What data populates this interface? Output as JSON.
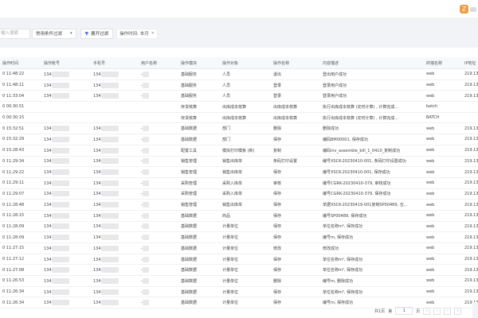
{
  "topbar": {
    "badge_text": "Z",
    "accent": "#f39a3c"
  },
  "filters": {
    "search_placeholder": "输入搜索",
    "common_filter": "常用条件过滤",
    "expand_label": "展开过滤",
    "tag_label": "操作时间: 本月"
  },
  "table": {
    "columns": [
      "操作时间",
      "操作账号",
      "手机号",
      "用户名称",
      "操作模块",
      "操作对象",
      "操作名称",
      "内容描述",
      "终端名称",
      "IP地址"
    ],
    "rows": [
      [
        "0 11:48:22",
        "134",
        "134",
        "-",
        "基础服务",
        "人员",
        "退出",
        "登出用户成功",
        "web",
        "219.13"
      ],
      [
        "0 11:48:11",
        "134",
        "134",
        "-",
        "基础服务",
        "人员",
        "登录",
        "登录用户成功",
        "web",
        "219.13"
      ],
      [
        "0 11:33:04",
        "134",
        "134",
        "-",
        "基础服务",
        "人员",
        "登录",
        "登录用户成功",
        "web",
        "219.13"
      ],
      [
        "0 00:30:51",
        "",
        "",
        "",
        "存货核算",
        "出库成本核算",
        "出库成本核算",
        "执行出库成本核算 (定时计算) , 计算完成...",
        "batch",
        ""
      ],
      [
        "0 00:30:15",
        "",
        "",
        "",
        "存货核算",
        "出库成本核算",
        "出库成本核算",
        "执行出库成本核算 (定时计算) , 计算完成...",
        "BATCH",
        ""
      ],
      [
        "0 15:32:51",
        "134",
        "134",
        "-",
        "基础数据",
        "部门",
        "删除",
        "删除成功",
        "web",
        "219.13"
      ],
      [
        "0 15:32:29",
        "134",
        "134",
        "-",
        "基础数据",
        "部门",
        "保存",
        "编码BM00001, 保存成功",
        "web",
        "219.13"
      ],
      [
        "0 15:28:43",
        "134",
        "134",
        "-",
        "配置工具",
        "模拟打印模板 (新)",
        "复制",
        "编码inv_assemble_bill_1_0410_复制成功",
        "web",
        "219.13"
      ],
      [
        "0 11:29:34",
        "134",
        "134",
        "-",
        "销售管理",
        "销售出库单",
        "条码打印设置",
        "编号XSCK-20230410-001, 条码打印设置成功",
        "web",
        "219.13"
      ],
      [
        "0 11:29:22",
        "134",
        "134",
        "-",
        "销售管理",
        "销售出库单",
        "保存",
        "编号XSCK-20230410-001, 保存成功",
        "web",
        "219.13"
      ],
      [
        "0 11:29:11",
        "134",
        "134",
        "-",
        "采购管理",
        "采购入库单",
        "审核",
        "编号CGRK-20230410-379, 审核成功",
        "web",
        "219.13"
      ],
      [
        "0 11:29:07",
        "134",
        "134",
        "-",
        "采购管理",
        "采购入库单",
        "保存",
        "编号CGRK-20230410-379, 保存成功",
        "web",
        "219.13"
      ],
      [
        "0 11:28:48",
        "134",
        "134",
        "-",
        "销售管理",
        "销售出库单",
        "保存",
        "单据XSCK-20230419-001复制SP00489, 仓...",
        "web",
        "219.13"
      ],
      [
        "0 11:28:15",
        "134",
        "134",
        "-",
        "基础数据",
        "商品",
        "保存",
        "编号SP00489, 保存成功",
        "web",
        "219.13"
      ],
      [
        "0 11:28:09",
        "134",
        "134",
        "-",
        "基础数据",
        "计量单位",
        "保存",
        "单位名称m², 保存成功",
        "web",
        "219.13"
      ],
      [
        "0 11:28:09",
        "134",
        "134",
        "-",
        "基础数据",
        "计量单位",
        "保存",
        "编号m, 保存成功",
        "web",
        "219.13"
      ],
      [
        "0 11:27:15",
        "134",
        "134",
        "-",
        "基础数据",
        "计量单位",
        "修改",
        "修改成功",
        "web",
        "219.13"
      ],
      [
        "0 11:27:12",
        "134",
        "134",
        "-",
        "基础数据",
        "计量单位",
        "保存",
        "单位名称m², 保存成功",
        "web",
        "219.13"
      ],
      [
        "0 11:27:08",
        "134",
        "134",
        "-",
        "基础数据",
        "计量单位",
        "保存",
        "单位名称m², 保存成功",
        "web",
        "219.13"
      ],
      [
        "0 11:26:53",
        "134",
        "134",
        "-",
        "基础数据",
        "计量单位",
        "删除",
        "编号m, 删除成功",
        "web",
        "219.13"
      ],
      [
        "0 11:26:34",
        "134",
        "134",
        "-",
        "基础数据",
        "计量单位",
        "保存",
        "单位名称m², 保存成功",
        "web",
        "219.13"
      ],
      [
        "0 11:26:34",
        "134",
        "134",
        "-",
        "基础数据",
        "计量单位",
        "保存",
        "编号m, 保存成功",
        "web",
        "219.13"
      ]
    ]
  },
  "pager": {
    "total_label": "共1页",
    "page_prefix": "第",
    "page_value": "1",
    "page_suffix": "页"
  }
}
